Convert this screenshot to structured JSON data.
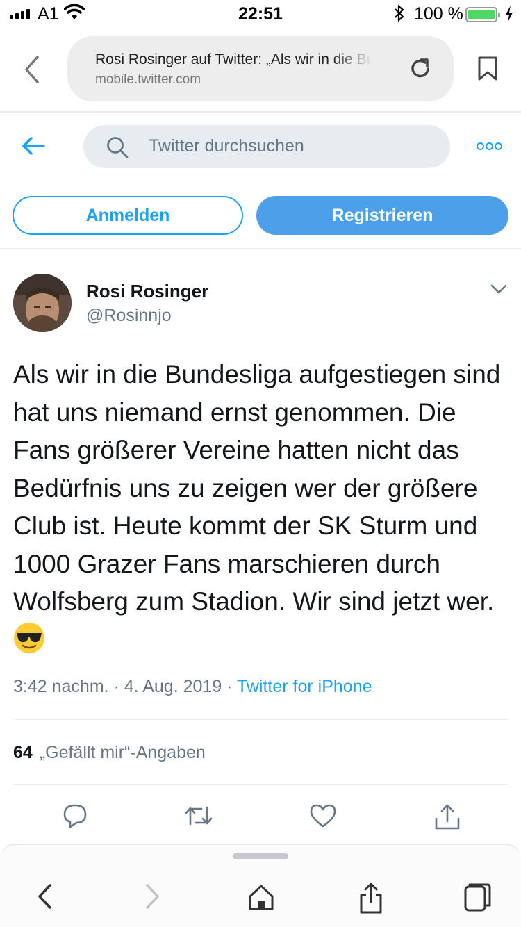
{
  "status_bar": {
    "carrier": "A1",
    "time": "22:51",
    "battery_percent": "100 %",
    "battery_level": 1.0
  },
  "browser": {
    "page_title": "Rosi Rosinger auf Twitter: „Als wir in die Bundesliga",
    "host": "mobile.twitter.com"
  },
  "twitter_header": {
    "search_placeholder": "Twitter durchsuchen",
    "login_label": "Anmelden",
    "register_label": "Registrieren"
  },
  "tweet": {
    "author_name": "Rosi Rosinger",
    "author_handle": "@Rosinnjo",
    "text": "Als wir in die Bundesliga aufgestiegen sind hat uns niemand ernst genommen. Die Fans größerer Vereine hatten nicht das Bedürfnis uns zu zeigen wer der größere Club ist. Heute kommt der SK Sturm und 1000 Grazer Fans marschieren durch Wolfsberg zum Stadion. Wir sind jetzt wer.",
    "time": "3:42 nachm.",
    "separator": " · ",
    "date": "4. Aug. 2019",
    "source": "Twitter for iPhone",
    "likes_count": "64",
    "likes_label": "„Gefällt mir“-Angaben"
  },
  "colors": {
    "accent": "#1da1f2",
    "register_button": "#4c9fe9",
    "secondary_text": "#657786",
    "battery_green": "#4cd964"
  },
  "icons": [
    "signal-icon",
    "wifi-icon",
    "bluetooth-icon",
    "battery-icon",
    "back-chevron-icon",
    "reload-icon",
    "bookmark-icon",
    "back-arrow-icon",
    "search-icon",
    "more-icon",
    "avatar",
    "chevron-down-icon",
    "sunglasses-emoji",
    "reply-icon",
    "retweet-icon",
    "like-icon",
    "share-icon",
    "forward-chevron-icon",
    "home-icon",
    "tabs-icon"
  ]
}
